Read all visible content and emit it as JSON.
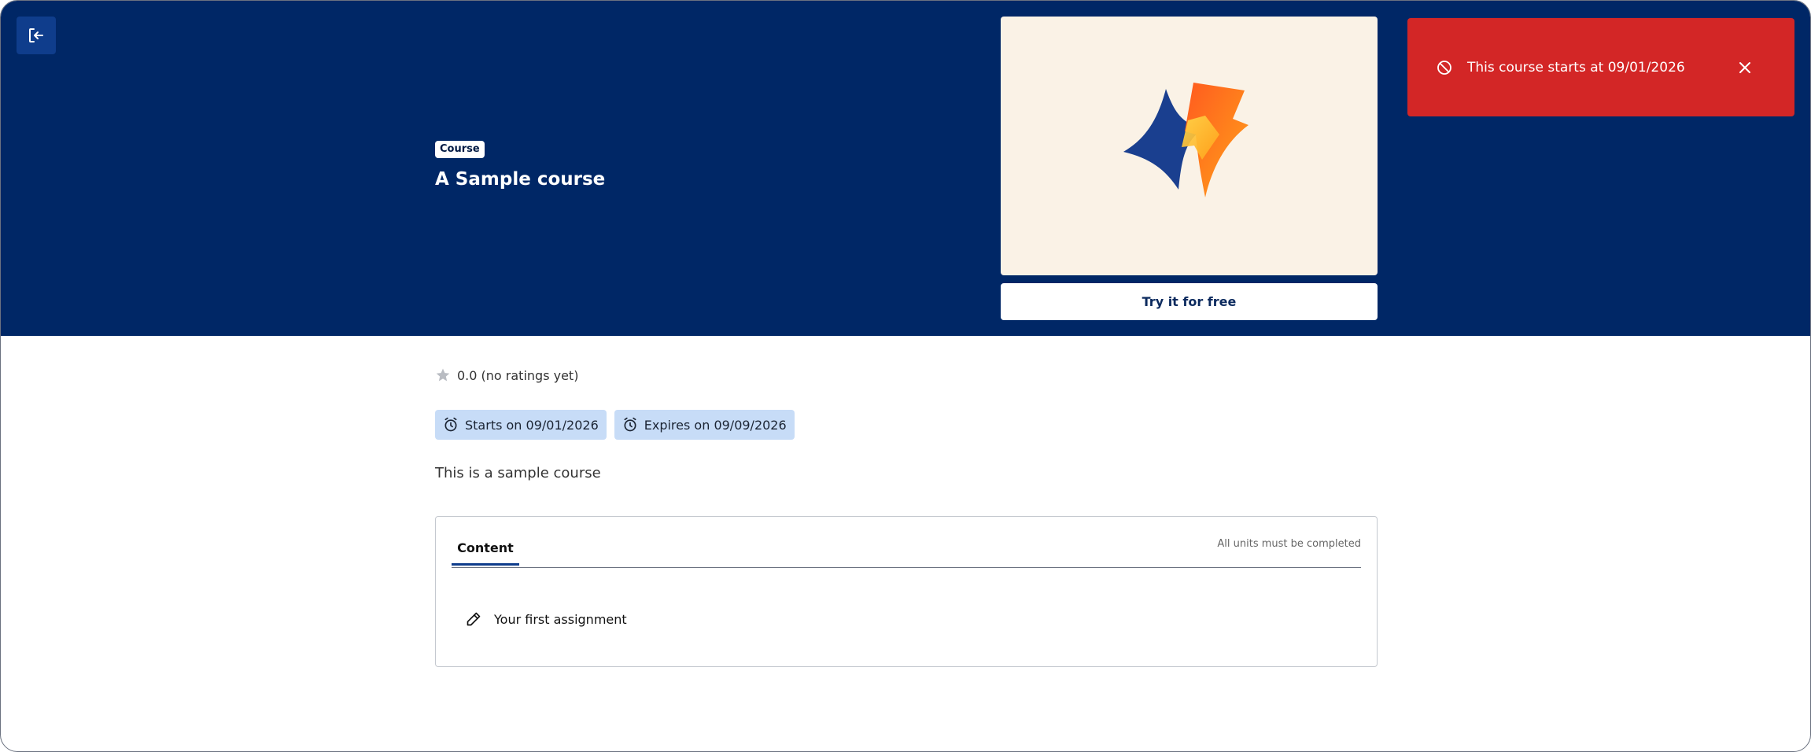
{
  "course": {
    "badge": "Course",
    "title": "A Sample course",
    "try_label": "Try it for free",
    "rating": "0.0 (no ratings yet)",
    "tags": {
      "start": "Starts on 09/01/2026",
      "expires": "Expires on 09/09/2026"
    },
    "description": "This is a sample course"
  },
  "toast": {
    "message": "This course starts at 09/01/2026",
    "color": "#d32626"
  },
  "content": {
    "tab_label": "Content",
    "hint": "All units must be completed",
    "units": [
      {
        "label": "Your first assignment",
        "icon": "pencil-icon"
      }
    ]
  },
  "colors": {
    "hero": "#002766",
    "accent": "#0f3d8c",
    "tag_bg": "#c7dcf7",
    "thumb_bg": "#faf2e6"
  },
  "icons": {
    "exit": "exit-icon",
    "star": "star-icon",
    "alarm": "alarm-clock-icon",
    "ban": "ban-icon",
    "close": "close-icon"
  }
}
